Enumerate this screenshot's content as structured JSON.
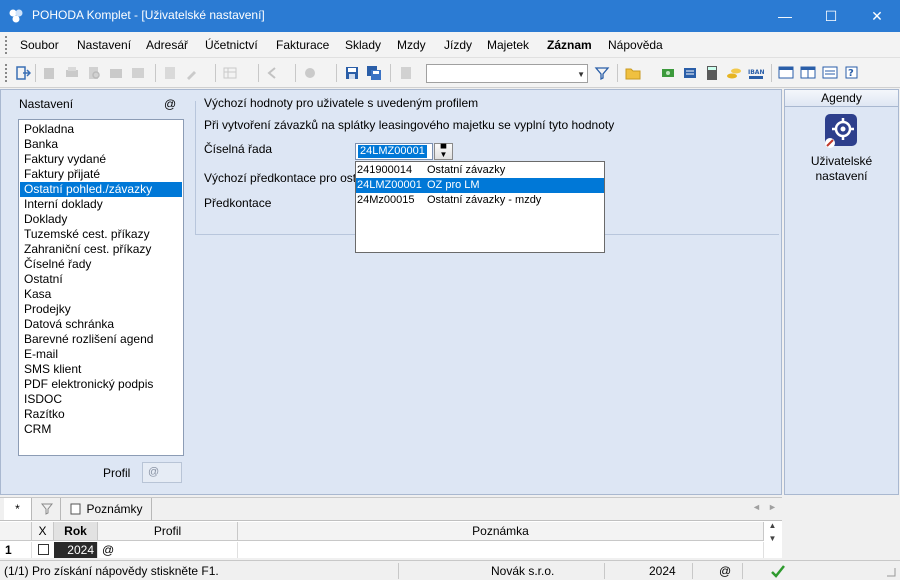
{
  "window": {
    "title": "POHODA Komplet - [Uživatelské nastavení]",
    "minimize": "—",
    "maximize": "☐",
    "close": "✕"
  },
  "menu": [
    "Soubor",
    "Nastavení",
    "Adresář",
    "Účetnictví",
    "Fakturace",
    "Sklady",
    "Mzdy",
    "Jízdy",
    "Majetek",
    "Záznam",
    "Nápověda"
  ],
  "settings": {
    "header": "Nastavení",
    "at": "@",
    "items": [
      "Pokladna",
      "Banka",
      "Faktury vydané",
      "Faktury přijaté",
      "Ostatní pohled./závazky",
      "Interní doklady",
      "Doklady",
      "Tuzemské cest. příkazy",
      "Zahraniční cest. příkazy",
      "Číselné řady",
      "Ostatní",
      "Kasa",
      "Prodejky",
      "Datová schránka",
      "Barevné rozlišení agend",
      "E-mail",
      "SMS klient",
      "PDF elektronický podpis",
      "ISDOC",
      "Razítko",
      "CRM"
    ],
    "selected_index": 4,
    "profil_label": "Profil",
    "profil_value": "@"
  },
  "detail": {
    "heading": "Výchozí hodnoty pro uživatele s uvedeným profilem",
    "subheading": "Při vytvoření závazků na splátky leasingového majetku se vyplní tyto hodnoty",
    "ciselna_rada_label": "Číselná řada",
    "ciselna_rada_value": "24LMZ00001",
    "predkontace_label_1": "Výchozí předkontace pro ost",
    "predkontace_label_2": "Předkontace",
    "dropdown": [
      {
        "code": "241900014",
        "name": "Ostatní závazky"
      },
      {
        "code": "24LMZ00001",
        "name": "OZ pro LM"
      },
      {
        "code": "24Mz00015",
        "name": "Ostatní závazky - mzdy"
      }
    ],
    "dropdown_selected": 1
  },
  "agendy": {
    "header": "Agendy",
    "item_label": "Uživatelské nastavení"
  },
  "bottom": {
    "tab_star": "*",
    "tab_notes": "Poznámky",
    "columns": [
      "X",
      "Rok",
      "Profil",
      "Poznámka"
    ],
    "row": {
      "num": "1",
      "rok": "2024",
      "profil": "@",
      "poznamka": ""
    }
  },
  "status": {
    "help": "(1/1) Pro získání nápovědy stiskněte F1.",
    "company": "Novák s.r.o.",
    "year": "2024",
    "at": "@"
  },
  "colors": {
    "titlebar": "#2b7bd3",
    "selection": "#0078d7",
    "pane": "#dde6f4"
  }
}
